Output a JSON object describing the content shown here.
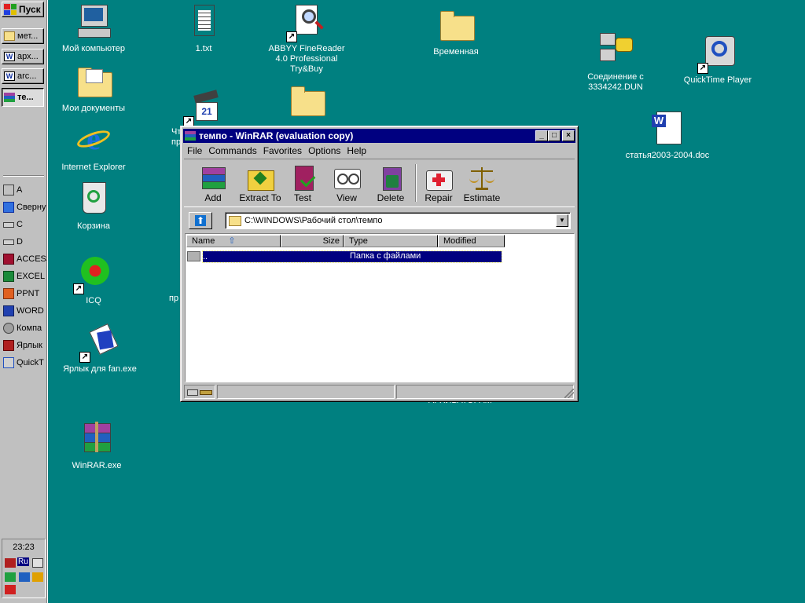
{
  "taskbar": {
    "start_label": "Пуск",
    "buttons": [
      {
        "label": "мет...",
        "icon": "folder-icon"
      },
      {
        "label": "арх...",
        "icon": "word-doc-icon"
      },
      {
        "label": "arc...",
        "icon": "word-doc-icon"
      },
      {
        "label": "те...",
        "icon": "winrar-icon"
      }
    ],
    "quick_items": [
      {
        "label": "A",
        "icon": "floppy-drive-icon"
      },
      {
        "label": "Сверну",
        "icon": "minimize-all-icon"
      },
      {
        "label": "C",
        "icon": "hard-drive-icon"
      },
      {
        "label": "D",
        "icon": "hard-drive-icon"
      },
      {
        "label": "ACCESS",
        "icon": "access-icon"
      },
      {
        "label": "EXCEL",
        "icon": "excel-icon"
      },
      {
        "label": "PPNT",
        "icon": "powerpoint-icon"
      },
      {
        "label": "WORD",
        "icon": "word-icon"
      },
      {
        "label": "Компа",
        "icon": "computer-icon"
      },
      {
        "label": "Ярлык",
        "icon": "shortcut-icon"
      },
      {
        "label": "QuickT",
        "icon": "quicktime-icon"
      }
    ],
    "clock": "23:23",
    "language": "Ru"
  },
  "desktop": {
    "icons": [
      {
        "label": "Мой компьютер",
        "icon": "my-computer-icon"
      },
      {
        "label": "Мои документы",
        "icon": "my-documents-icon"
      },
      {
        "label": "Internet Explorer",
        "icon": "internet-explorer-icon"
      },
      {
        "label": "Корзина",
        "icon": "recycle-bin-icon"
      },
      {
        "label": "ICQ",
        "icon": "icq-icon"
      },
      {
        "label": "Ярлык для fan.exe",
        "icon": "fan-shortcut-icon"
      },
      {
        "label": "WinRAR.exe",
        "icon": "winrar-exe-icon"
      },
      {
        "label": "1.txt",
        "icon": "text-file-icon"
      },
      {
        "label": "ABBYY FineReader  4.0 Professional Try&Buy",
        "icon": "finereader-icon"
      },
      {
        "label": "Временная",
        "icon": "folder-icon"
      },
      {
        "label": "Соединение с 3334242.DUN",
        "icon": "dialup-connection-icon"
      },
      {
        "label": "QuickTime Player",
        "icon": "quicktime-player-icon"
      },
      {
        "label": "статья2003-2004.doc",
        "icon": "word-doc-icon"
      },
      {
        "label": "",
        "icon": "calendar-shortcut-icon"
      },
      {
        "label": "",
        "icon": "folder-icon"
      }
    ],
    "partial_labels": [
      "Чт",
      "пр",
      "пр",
      "АРХИВАТОРАМ"
    ]
  },
  "winrar": {
    "title": "темпо - WinRAR (evaluation copy)",
    "menu": [
      "File",
      "Commands",
      "Favorites",
      "Options",
      "Help"
    ],
    "toolbar": [
      {
        "label": "Add",
        "icon": "add-archive-icon"
      },
      {
        "label": "Extract To",
        "icon": "extract-to-icon"
      },
      {
        "label": "Test",
        "icon": "test-icon"
      },
      {
        "label": "View",
        "icon": "view-icon"
      },
      {
        "label": "Delete",
        "icon": "delete-icon"
      },
      {
        "label": "Repair",
        "icon": "repair-icon"
      },
      {
        "label": "Estimate",
        "icon": "estimate-icon"
      }
    ],
    "path": "C:\\WINDOWS\\Рабочий стол\\темпо",
    "columns": [
      "Name",
      "Size",
      "Type",
      "Modified"
    ],
    "rows": [
      {
        "name": "..",
        "size": "",
        "type": "Папка с файлами",
        "modified": ""
      }
    ],
    "colors": {
      "titlebar": "#000080",
      "selection": "#000080"
    }
  }
}
